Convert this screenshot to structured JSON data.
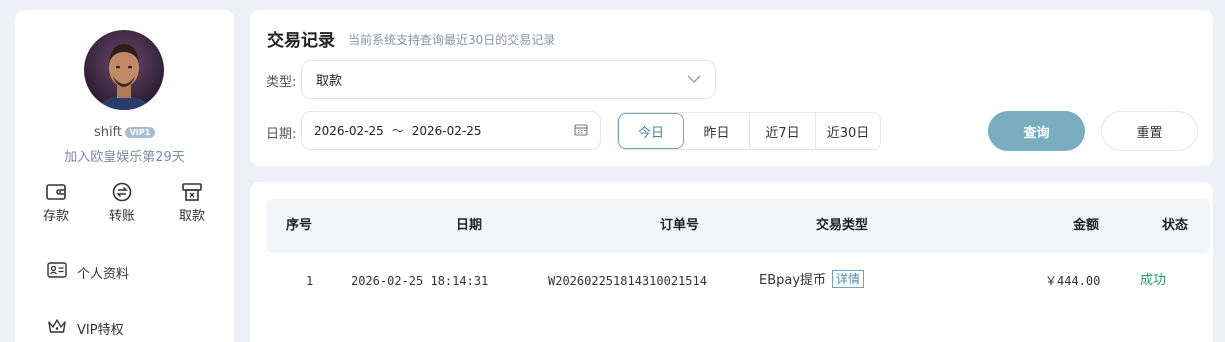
{
  "sidebar": {
    "username": "shift",
    "vip_level": "VIP1",
    "join_text": "加入欧皇娱乐第29天",
    "actions": [
      {
        "label": "存款",
        "icon": "wallet-icon"
      },
      {
        "label": "转账",
        "icon": "transfer-icon"
      },
      {
        "label": "取款",
        "icon": "withdraw-icon"
      }
    ],
    "menu": [
      {
        "label": "个人资料",
        "icon": "id-card-icon"
      },
      {
        "label": "VIP特权",
        "icon": "crown-icon"
      }
    ]
  },
  "page": {
    "title": "交易记录",
    "subtitle": "当前系统支持查询最近30日的交易记录"
  },
  "filters": {
    "type_label": "类型:",
    "type_value": "取款",
    "date_label": "日期:",
    "date_start": "2026-02-25",
    "date_sep": "～",
    "date_end": "2026-02-25",
    "quick_ranges": [
      "今日",
      "昨日",
      "近7日",
      "近30日"
    ],
    "active_range": "今日",
    "query_label": "查询",
    "reset_label": "重置"
  },
  "table": {
    "headers": [
      "序号",
      "日期",
      "订单号",
      "交易类型",
      "金额",
      "状态"
    ],
    "rows": [
      {
        "index": "1",
        "date": "2026-02-25 18:14:31",
        "order_no": "W202602251814310021514",
        "type": "EBpay提币",
        "detail_label": "详情",
        "amount": "￥444.00",
        "status": "成功"
      }
    ]
  },
  "colors": {
    "accent": "#7aadbf",
    "success": "#22a06b",
    "muted": "#8a94a6"
  }
}
